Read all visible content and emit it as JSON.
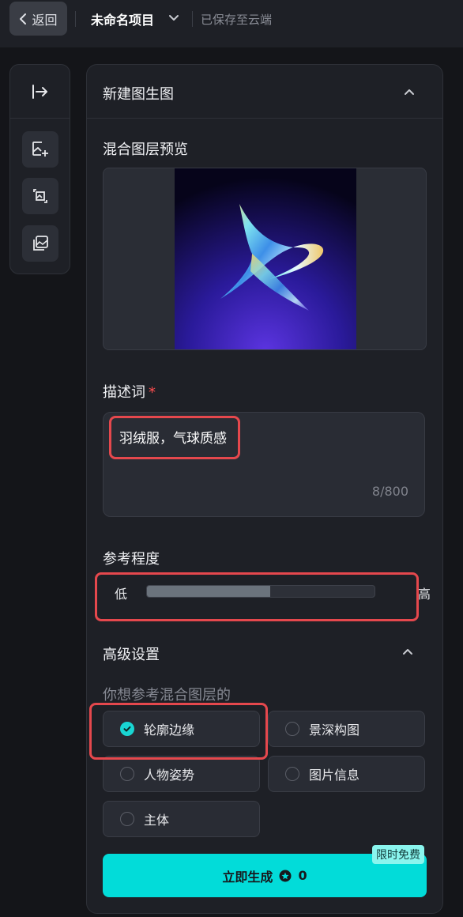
{
  "topbar": {
    "back_label": "返回",
    "project_title": "未命名项目",
    "saved_status": "已保存至云端"
  },
  "left_toolbar": {
    "icons": [
      "expand-panel-icon",
      "image-add-icon",
      "image-transform-icon",
      "image-gallery-icon"
    ]
  },
  "panel": {
    "title": "新建图生图",
    "preview_label": "混合图层预览",
    "prompt_label": "描述词",
    "prompt_required_mark": "*",
    "prompt_value": "羽绒服，气球质感",
    "prompt_count": "8/800",
    "reference_label": "参考程度",
    "reference_low": "低",
    "reference_high": "高",
    "reference_level": 0.54,
    "advanced_label": "高级设置",
    "advanced_question": "你想参考混合图层的",
    "options": [
      {
        "label": "轮廓边缘",
        "checked": true
      },
      {
        "label": "景深构图",
        "checked": false
      },
      {
        "label": "人物姿势",
        "checked": false
      },
      {
        "label": "图片信息",
        "checked": false
      },
      {
        "label": "主体",
        "checked": false
      }
    ],
    "generate_label": "立即生成",
    "generate_cost": "0",
    "promo_badge": "限时免费"
  },
  "colors": {
    "accent": "#02dcd9",
    "highlight": "#e5484d",
    "background": "#141519",
    "panel": "#1e2026"
  }
}
